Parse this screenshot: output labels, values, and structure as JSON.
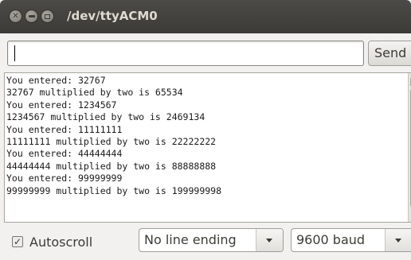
{
  "window": {
    "title": "/dev/ttyACM0"
  },
  "input": {
    "value": ""
  },
  "toolbar": {
    "send_label": "Send"
  },
  "serial_output": {
    "lines": [
      "You entered: 32767",
      "32767 multiplied by two is 65534",
      "You entered: 1234567",
      "1234567 multiplied by two is 2469134",
      "You entered: 11111111",
      "11111111 multiplied by two is 22222222",
      "You entered: 44444444",
      "44444444 multiplied by two is 88888888",
      "You entered: 99999999",
      "99999999 multiplied by two is 199999998"
    ]
  },
  "footer": {
    "autoscroll_label": "Autoscroll",
    "autoscroll_checked": true,
    "line_ending_selected": "No line ending",
    "baud_selected": "9600 baud"
  },
  "icons": {
    "close": "close-icon",
    "minimize": "minimize-icon",
    "maximize": "maximize-icon",
    "dropdown": "chevron-down-icon"
  }
}
